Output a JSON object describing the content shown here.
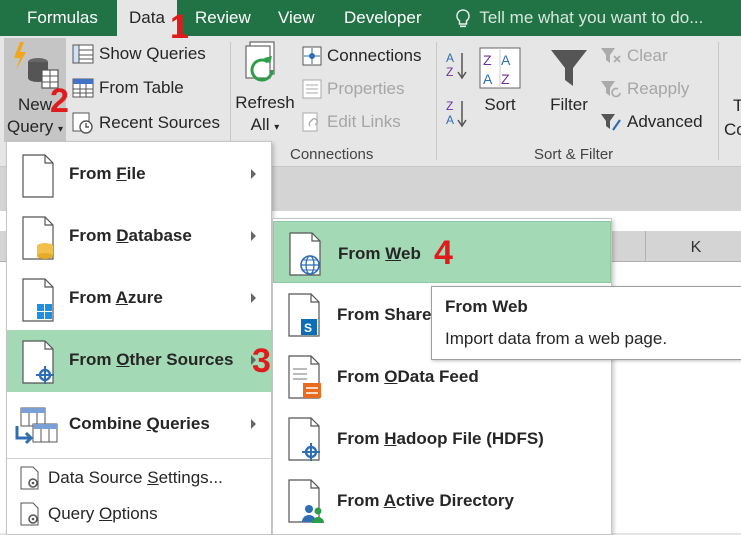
{
  "tabs": [
    {
      "label": "Formulas"
    },
    {
      "label": "Data"
    },
    {
      "label": "Review"
    },
    {
      "label": "View"
    },
    {
      "label": "Developer"
    }
  ],
  "tell_me": "Tell me what you want to do...",
  "ribbon": {
    "get_transform": {
      "new_query_line1": "New",
      "new_query_line2": "Query",
      "show_queries": "Show Queries",
      "from_table": "From Table",
      "recent_sources": "Recent Sources"
    },
    "connections": {
      "refresh_line1": "Refresh",
      "refresh_line2": "All",
      "connections": "Connections",
      "properties": "Properties",
      "edit_links": "Edit Links",
      "group_label": "Connections"
    },
    "sort_filter": {
      "sort": "Sort",
      "filter": "Filter",
      "clear": "Clear",
      "reapply": "Reapply",
      "advanced": "Advanced",
      "group_label": "Sort & Filter"
    },
    "partial_label_top": "T",
    "partial_label_bottom": "Co"
  },
  "column_header_k": "K",
  "new_query_menu": {
    "items": [
      {
        "pre": "From ",
        "key": "F",
        "post": "ile"
      },
      {
        "pre": "From ",
        "key": "D",
        "post": "atabase"
      },
      {
        "pre": "From ",
        "key": "A",
        "post": "zure"
      },
      {
        "pre": "From ",
        "key": "O",
        "post": "ther Sources"
      },
      {
        "pre": "Combine ",
        "key": "Q",
        "post": "ueries"
      }
    ],
    "settings": {
      "pre": "Data Source ",
      "key": "S",
      "post": "ettings..."
    },
    "options": {
      "pre": "Query ",
      "key": "O",
      "post": "ptions"
    }
  },
  "other_sources_menu": {
    "items": [
      {
        "pre": "From ",
        "key": "W",
        "post": "eb"
      },
      {
        "pre": "From Share",
        "key": "",
        "post": ""
      },
      {
        "pre": "From ",
        "key": "O",
        "post": "Data Feed"
      },
      {
        "pre": "From ",
        "key": "H",
        "post": "adoop File (HDFS)"
      },
      {
        "pre": "From ",
        "key": "A",
        "post": "ctive Directory"
      }
    ]
  },
  "tooltip": {
    "title": "From Web",
    "description": "Import data from a web page."
  },
  "steps": [
    "1",
    "2",
    "3",
    "4"
  ],
  "colors": {
    "ribbon_tab_bar": "#217346",
    "highlight": "#a3d9b5",
    "step_marker": "#e01b1b"
  }
}
